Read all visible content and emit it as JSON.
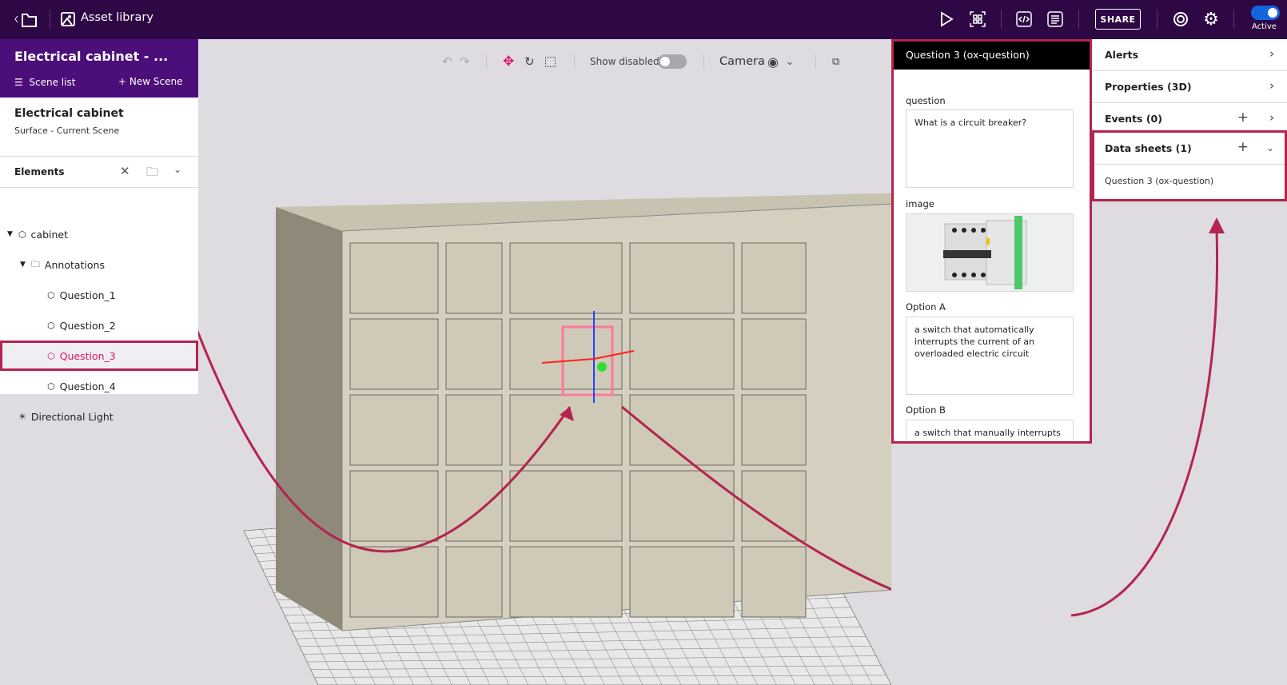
{
  "topbar": {
    "title": "Asset library",
    "share": "SHARE",
    "active_label": "Active",
    "active": true,
    "icons": [
      "back-folder-icon",
      "image-icon",
      "play-icon",
      "qr-code-icon",
      "code-icon",
      "document-icon",
      "help-lifebuoy-icon",
      "settings-gear-icon"
    ]
  },
  "left": {
    "project_title": "Electrical cabinet - ...",
    "scene_list": "Scene list",
    "new_scene": "New Scene",
    "scene_name": "Electrical cabinet",
    "scene_sub": "Surface - Current Scene",
    "elements": "Elements",
    "tree": [
      {
        "label": "cabinet"
      },
      {
        "label": "Annotations"
      },
      {
        "label": "Question_1"
      },
      {
        "label": "Question_2"
      },
      {
        "label": "Question_3",
        "selected": true
      },
      {
        "label": "Question_4"
      },
      {
        "label": "Directional Light"
      }
    ]
  },
  "viewport": {
    "show_disabled": "Show disabled",
    "show_disabled_on": false,
    "camera": "Camera"
  },
  "question_panel": {
    "title": "Question 3 (ox-question)",
    "question_label": "question",
    "question_value": "What is a circuit breaker?",
    "image_label": "image",
    "option_a_label": "Option A",
    "option_a_value": "a switch that automatically interrupts the current of an overloaded electric circuit",
    "option_b_label": "Option B",
    "option_b_value": "a switch that manually interrupts the current of an overloaded circuit"
  },
  "right_panel": {
    "alerts": "Alerts",
    "properties": "Properties (3D)",
    "events": "Events (0)",
    "data_sheets": "Data sheets (1)",
    "data_sheet_item": "Question 3 (ox-question)"
  },
  "colors": {
    "topbar": "#2d0845",
    "left_header": "#4c0e78",
    "highlight": "#b5234f",
    "selected_text": "#e0106f",
    "active_toggle": "#1565e0"
  }
}
